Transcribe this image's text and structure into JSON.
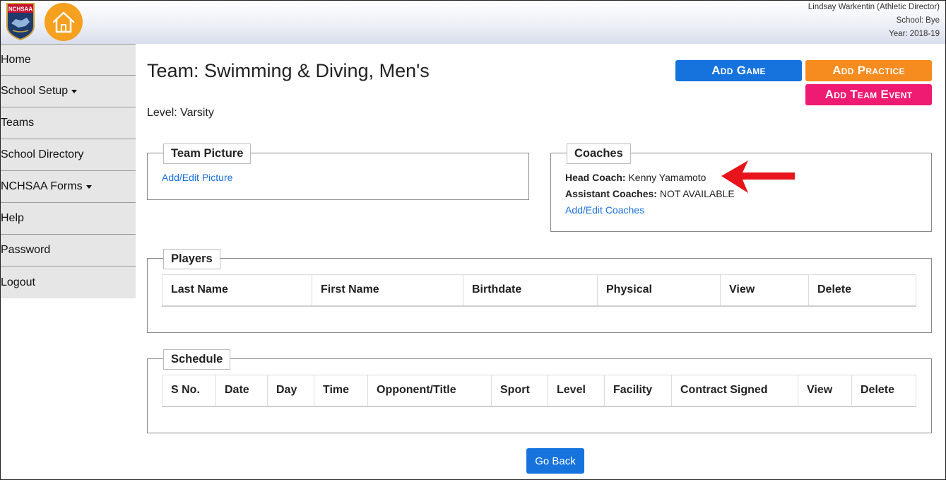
{
  "header": {
    "logo_text": "NCHSAA",
    "user_name": "Lindsay Warkentin (Athletic Director)",
    "school": "School: Bye",
    "year": "Year: 2018-19",
    "home_icon": "house-icon"
  },
  "sidebar": {
    "items": [
      {
        "label": "Home",
        "dropdown": false
      },
      {
        "label": "School Setup",
        "dropdown": true
      },
      {
        "label": "Teams",
        "dropdown": false
      },
      {
        "label": "School Directory",
        "dropdown": false
      },
      {
        "label": "NCHSAA Forms",
        "dropdown": true
      },
      {
        "label": "Help",
        "dropdown": false
      },
      {
        "label": "Password",
        "dropdown": false
      },
      {
        "label": "Logout",
        "dropdown": false
      }
    ]
  },
  "main": {
    "title": "Team: Swimming & Diving, Men's",
    "level": "Level: Varsity",
    "buttons": {
      "add_game": "Add Game",
      "add_practice": "Add Practice",
      "add_team_event": "Add Team Event",
      "go_back": "Go Back"
    },
    "team_picture": {
      "legend": "Team Picture",
      "link": "Add/Edit Picture"
    },
    "coaches": {
      "legend": "Coaches",
      "head_coach_label": "Head Coach:",
      "head_coach_value": "Kenny Yamamoto",
      "assistant_label": "Assistant Coaches:",
      "assistant_value": "NOT AVAILABLE",
      "link": "Add/Edit Coaches"
    },
    "players": {
      "legend": "Players",
      "columns": [
        "Last Name",
        "First Name",
        "Birthdate",
        "Physical",
        "View",
        "Delete"
      ]
    },
    "schedule": {
      "legend": "Schedule",
      "columns": [
        "S No.",
        "Date",
        "Day",
        "Time",
        "Opponent/Title",
        "Sport",
        "Level",
        "Facility",
        "Contract Signed",
        "View",
        "Delete"
      ]
    }
  },
  "colors": {
    "add_game": "#1673de",
    "add_practice": "#f68b1f",
    "add_team_event": "#ef1a72",
    "home_button": "#f5a01f",
    "link": "#1a6fe0",
    "annotation_arrow": "#e8141b"
  }
}
